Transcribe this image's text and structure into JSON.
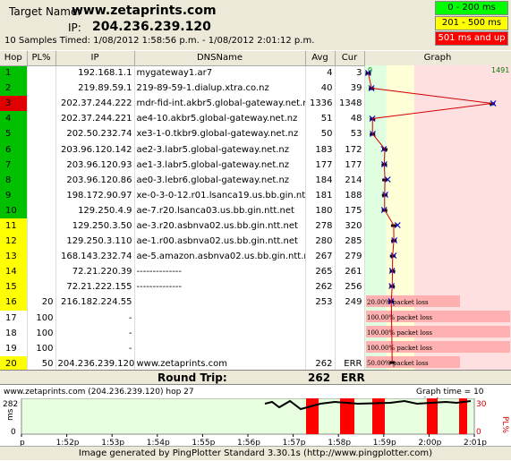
{
  "header": {
    "target_label": "Target Name:",
    "target": "www.zetaprints.com",
    "ip_label": "IP:",
    "ip": "204.236.239.120",
    "samples": "10 Samples Timed:  1/08/2012 1:58:56 p.m. - 1/08/2012 2:01:12 p.m."
  },
  "legend": [
    {
      "label": "0 - 200 ms",
      "color": "#00ff00"
    },
    {
      "label": "201 - 500 ms",
      "color": "#ffff00"
    },
    {
      "label": "501 ms and up",
      "color": "#ff0000"
    }
  ],
  "columns": [
    "Hop",
    "PL%",
    "IP",
    "DNSName",
    "Avg",
    "Cur",
    "Graph"
  ],
  "graph": {
    "min_label": "0",
    "max_label": "1491"
  },
  "hops": [
    {
      "hop": "1",
      "pl": "",
      "ip": "192.168.1.1",
      "dns": "mygateway1.ar7",
      "avg": "4",
      "cur": "3",
      "color": "#00c000"
    },
    {
      "hop": "2",
      "pl": "",
      "ip": "219.89.59.1",
      "dns": "219-89-59-1.dialup.xtra.co.nz",
      "avg": "40",
      "cur": "39",
      "color": "#00c000"
    },
    {
      "hop": "3",
      "pl": "",
      "ip": "202.37.244.222",
      "dns": "mdr-fid-int.akbr5.global-gateway.net.nz",
      "avg": "1336",
      "cur": "1348",
      "color": "#e00000"
    },
    {
      "hop": "4",
      "pl": "",
      "ip": "202.37.244.221",
      "dns": "ae4-10.akbr5.global-gateway.net.nz",
      "avg": "51",
      "cur": "48",
      "color": "#00c000"
    },
    {
      "hop": "5",
      "pl": "",
      "ip": "202.50.232.74",
      "dns": "xe3-1-0.tkbr9.global-gateway.net.nz",
      "avg": "50",
      "cur": "53",
      "color": "#00c000"
    },
    {
      "hop": "6",
      "pl": "",
      "ip": "203.96.120.142",
      "dns": "ae2-3.labr5.global-gateway.net.nz",
      "avg": "183",
      "cur": "172",
      "color": "#00c000"
    },
    {
      "hop": "7",
      "pl": "",
      "ip": "203.96.120.93",
      "dns": "ae1-3.labr5.global-gateway.net.nz",
      "avg": "177",
      "cur": "177",
      "color": "#00c000"
    },
    {
      "hop": "8",
      "pl": "",
      "ip": "203.96.120.86",
      "dns": "ae0-3.lebr6.global-gateway.net.nz",
      "avg": "184",
      "cur": "214",
      "color": "#00c000"
    },
    {
      "hop": "9",
      "pl": "",
      "ip": "198.172.90.97",
      "dns": "xe-0-3-0-12.r01.lsanca19.us.bb.gin.ntt.net",
      "avg": "181",
      "cur": "188",
      "color": "#00c000"
    },
    {
      "hop": "10",
      "pl": "",
      "ip": "129.250.4.9",
      "dns": "ae-7.r20.lsanca03.us.bb.gin.ntt.net",
      "avg": "180",
      "cur": "175",
      "color": "#00c000"
    },
    {
      "hop": "11",
      "pl": "",
      "ip": "129.250.3.50",
      "dns": "ae-3.r20.asbnva02.us.bb.gin.ntt.net",
      "avg": "278",
      "cur": "320",
      "color": "#ffff00"
    },
    {
      "hop": "12",
      "pl": "",
      "ip": "129.250.3.110",
      "dns": "ae-1.r00.asbnva02.us.bb.gin.ntt.net",
      "avg": "280",
      "cur": "285",
      "color": "#ffff00"
    },
    {
      "hop": "13",
      "pl": "",
      "ip": "168.143.232.74",
      "dns": "ae-5.amazon.asbnva02.us.bb.gin.ntt.net",
      "avg": "267",
      "cur": "279",
      "color": "#ffff00"
    },
    {
      "hop": "14",
      "pl": "",
      "ip": "72.21.220.39",
      "dns": "--------------",
      "avg": "265",
      "cur": "261",
      "color": "#ffff00"
    },
    {
      "hop": "15",
      "pl": "",
      "ip": "72.21.222.155",
      "dns": "--------------",
      "avg": "262",
      "cur": "256",
      "color": "#ffff00"
    },
    {
      "hop": "16",
      "pl": "20",
      "ip": "216.182.224.55",
      "dns": "",
      "avg": "253",
      "cur": "249",
      "color": "#ffff00"
    },
    {
      "hop": "17",
      "pl": "100",
      "ip": "-",
      "dns": "",
      "avg": "",
      "cur": "",
      "color": ""
    },
    {
      "hop": "18",
      "pl": "100",
      "ip": "-",
      "dns": "",
      "avg": "",
      "cur": "",
      "color": ""
    },
    {
      "hop": "19",
      "pl": "100",
      "ip": "-",
      "dns": "",
      "avg": "",
      "cur": "",
      "color": ""
    },
    {
      "hop": "20",
      "pl": "50",
      "ip": "204.236.239.120",
      "dns": "www.zetaprints.com",
      "avg": "262",
      "cur": "ERR",
      "color": "#ffff00"
    }
  ],
  "loss_labels": {
    "16": "20.00% packet loss",
    "17": "100.00% packet loss",
    "18": "100.00% packet loss",
    "19": "100.00% packet loss",
    "20": "50.00% packet loss"
  },
  "roundtrip": {
    "label": "Round Trip:",
    "avg": "262",
    "cur": "ERR"
  },
  "timeline": {
    "title": "www.zetaprints.com (204.236.239.120) hop 27",
    "graph_time": "Graph time = 10 minutes",
    "ms_label": "ms",
    "pl_label": "PL%",
    "ticks": [
      "p",
      "1:52p",
      "1:53p",
      "1:54p",
      "1:55p",
      "1:56p",
      "1:57p",
      "1:58p",
      "1:59p",
      "2:00p",
      "2:01p"
    ],
    "y_labels": [
      "282",
      "0"
    ],
    "pl_labels": [
      "30",
      "0"
    ]
  },
  "footer": "Image generated by PingPlotter Standard 3.30.1s (http://www.pingplotter.com)"
}
